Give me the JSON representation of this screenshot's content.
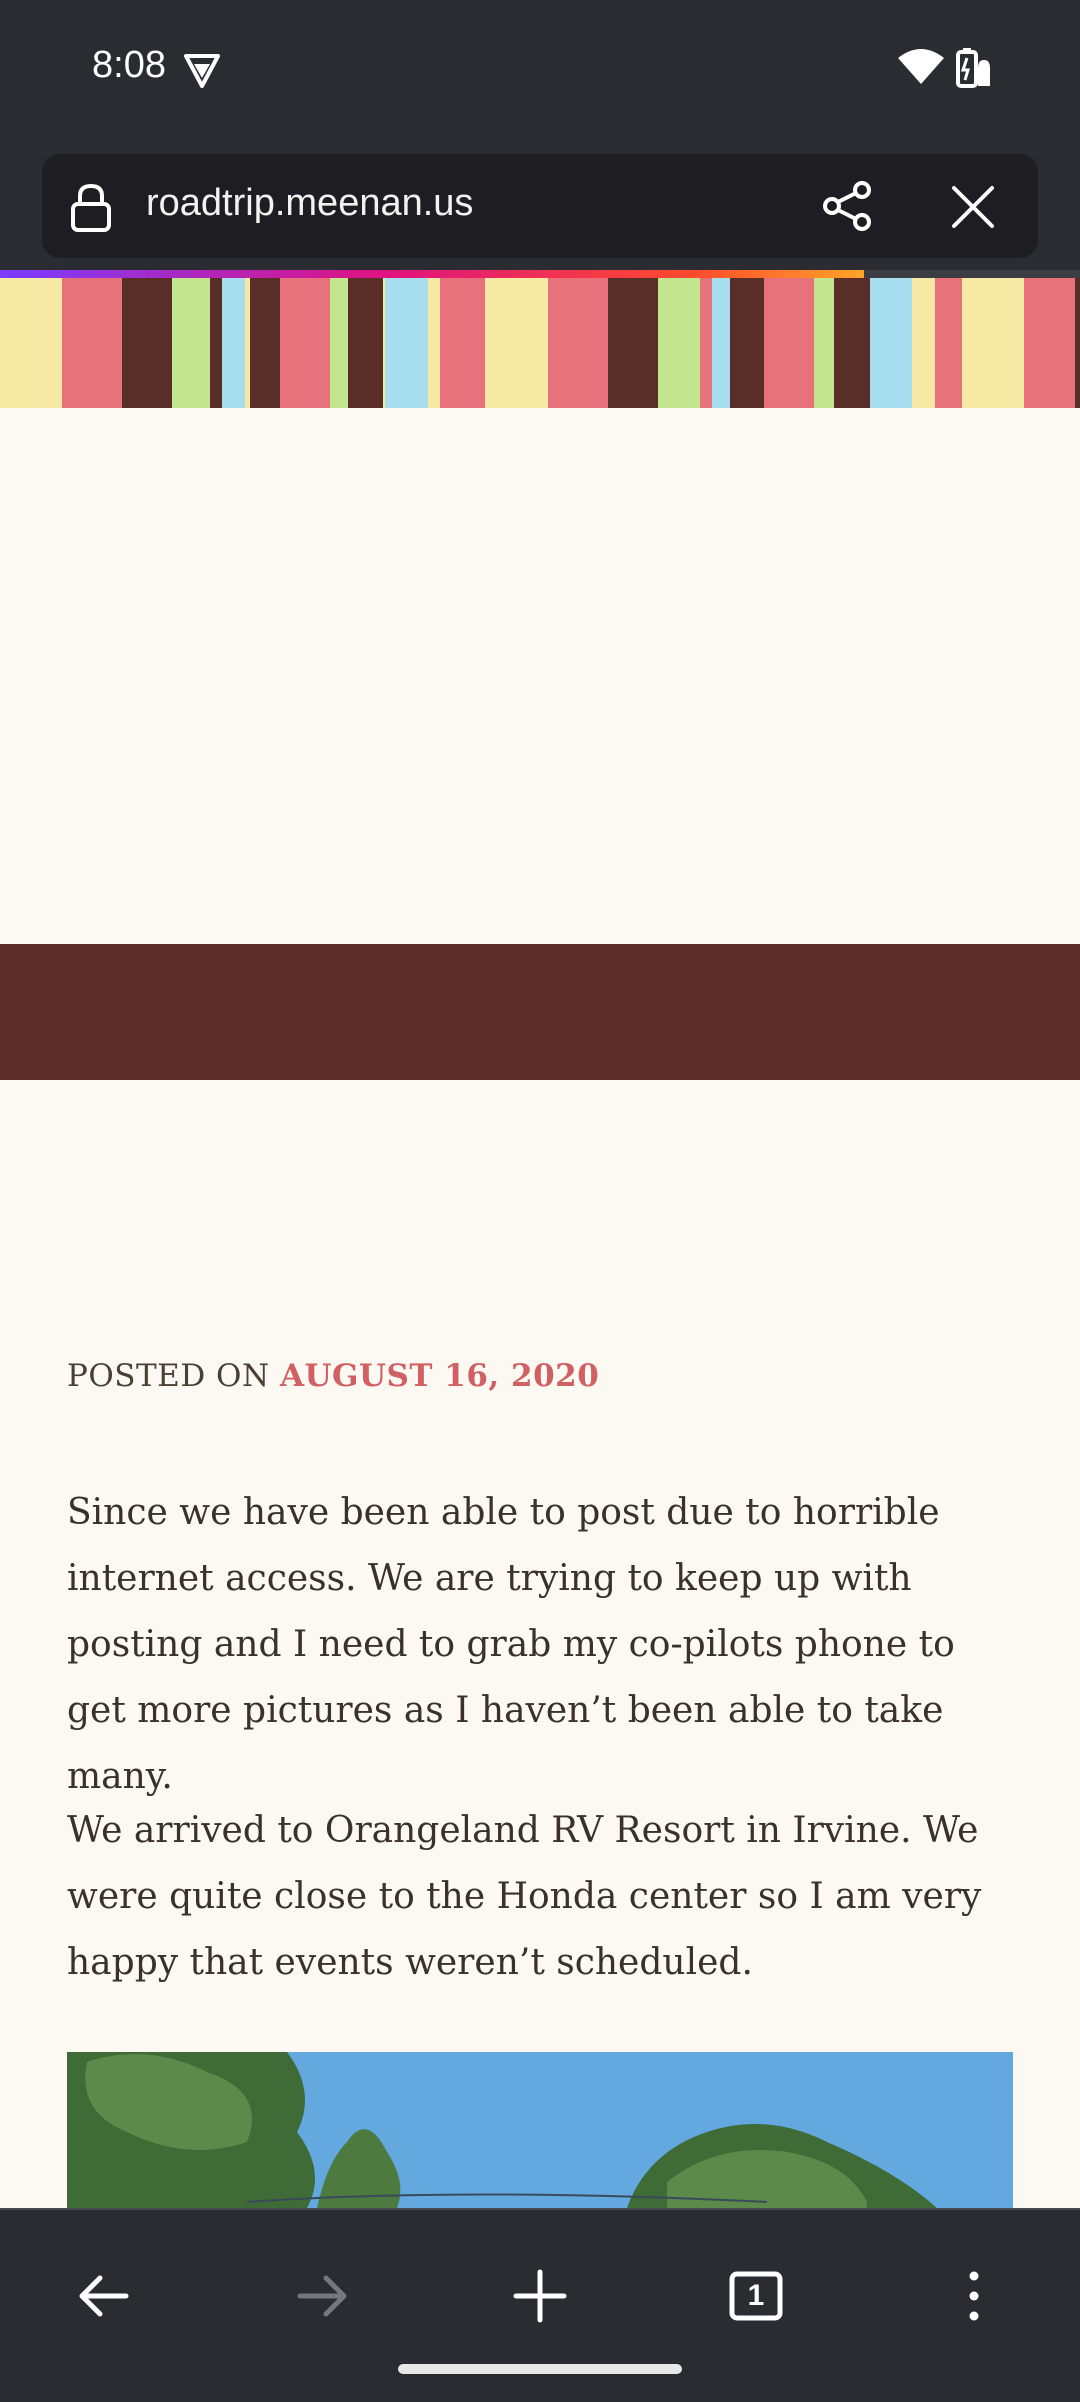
{
  "status_bar": {
    "time": "8:08"
  },
  "browser": {
    "url": "roadtrip.meenan.us",
    "load_progress": 0.8,
    "tab_count": "1"
  },
  "post": {
    "posted_prefix": "POSTED ON",
    "posted_date": "AUGUST 16, 2020",
    "paragraphs": [
      "Since we have been able to post due to horrible internet access. We are trying to keep up with posting and I need to grab my co-pilots phone to get more pictures as I haven’t been able to take many.",
      "We arrived to Orangeland RV Resort in Irvine. We were quite close to the Honda center so I am very happy that events weren’t scheduled."
    ]
  },
  "icons": {
    "status": [
      "vpn-icon",
      "wifi-icon",
      "battery-icon"
    ],
    "toolbar": [
      "lock-icon",
      "share-icon",
      "close-icon"
    ],
    "bottom": [
      "back-arrow-icon",
      "forward-arrow-icon",
      "plus-icon",
      "tabs-icon",
      "more-vert-icon"
    ]
  },
  "colors": {
    "chrome": "#2b2b32",
    "page_bg": "#fbf9f1",
    "date_accent": "#d06064",
    "maroon_band": "#5c2c2a"
  }
}
